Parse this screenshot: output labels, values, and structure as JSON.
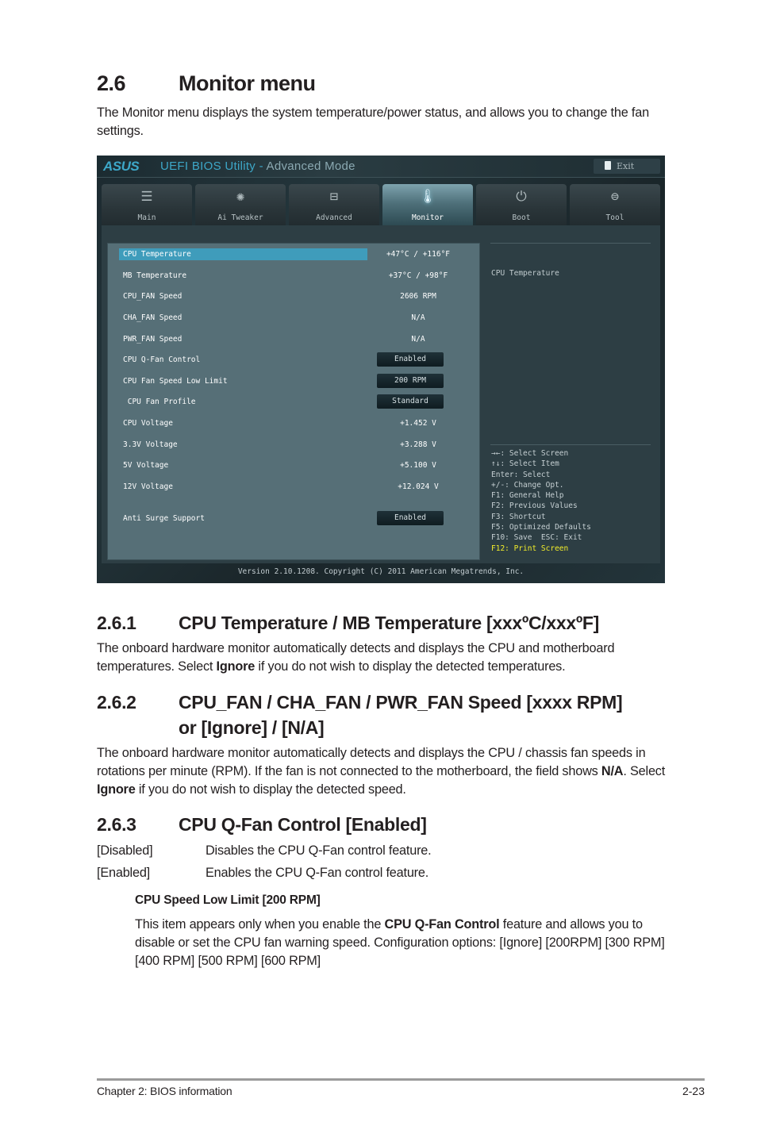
{
  "section": {
    "number": "2.6",
    "title": "Monitor menu",
    "intro": "The Monitor menu displays the system temperature/power status, and allows you to change the fan settings."
  },
  "bios": {
    "logo": "ASUS",
    "title": "UEFI BIOS Utility - ",
    "mode": "Advanced Mode",
    "exit_label": "Exit",
    "tabs": [
      {
        "label": "Main",
        "icon": "list-icon",
        "glyph": "☰",
        "active": false
      },
      {
        "label": "Ai Tweaker",
        "icon": "tweaker-icon",
        "glyph": "✺",
        "active": false
      },
      {
        "label": "Advanced",
        "icon": "advanced-icon",
        "glyph": "⊟",
        "active": false
      },
      {
        "label": "Monitor",
        "icon": "thermometer-icon",
        "glyph": "🌡",
        "active": true
      },
      {
        "label": "Boot",
        "icon": "power-icon",
        "glyph": "⏻",
        "active": false
      },
      {
        "label": "Tool",
        "icon": "toolbox-icon",
        "glyph": "⊜",
        "active": false
      }
    ],
    "items": [
      {
        "label": "CPU Temperature",
        "value": "+47°C / +116°F",
        "type": "text",
        "selected": true
      },
      {
        "label": "MB Temperature",
        "value": "+37°C / +98°F",
        "type": "text"
      },
      {
        "label": "CPU_FAN Speed",
        "value": "2606 RPM",
        "type": "text"
      },
      {
        "label": "CHA_FAN Speed",
        "value": "N/A",
        "type": "text"
      },
      {
        "label": "PWR_FAN Speed",
        "value": "N/A",
        "type": "text"
      },
      {
        "label": "CPU Q-Fan Control",
        "value": "Enabled",
        "type": "button"
      },
      {
        "label": "CPU Fan Speed Low Limit",
        "value": "200 RPM",
        "type": "button"
      },
      {
        "label": " CPU Fan Profile",
        "value": "Standard",
        "type": "button"
      },
      {
        "label": "CPU Voltage",
        "value": "+1.452 V",
        "type": "text"
      },
      {
        "label": "3.3V Voltage",
        "value": "+3.288 V",
        "type": "text"
      },
      {
        "label": "5V Voltage",
        "value": "+5.100 V",
        "type": "text"
      },
      {
        "label": "12V Voltage",
        "value": "+12.024 V",
        "type": "text"
      },
      {
        "label": "Anti Surge Support",
        "value": "Enabled",
        "type": "button"
      }
    ],
    "help_text": "CPU Temperature",
    "keys": [
      "→←: Select Screen",
      "↑↓: Select Item",
      "Enter: Select",
      "+/-: Change Opt.",
      "F1: General Help",
      "F2: Previous Values",
      "F3: Shortcut",
      "F5: Optimized Defaults",
      "F10: Save  ESC: Exit",
      "F12: Print Screen"
    ],
    "version": "Version 2.10.1208. Copyright (C) 2011 American Megatrends, Inc.",
    "colors": {
      "accent": "#3da7c8",
      "highlight_key": "#f3ee2a",
      "panel": "#566f77"
    }
  },
  "s261": {
    "number": "2.6.1",
    "title": "CPU Temperature / MB Temperature [xxxºC/xxxºF]",
    "p1": "The onboard hardware monitor automatically detects and displays the CPU and motherboard temperatures. Select ",
    "p1_bold": "Ignore",
    "p1_end": " if you do not wish to display the detected temperatures."
  },
  "s262": {
    "number": "2.6.2",
    "title_line1": "CPU_FAN / CHA_FAN / PWR_FAN Speed [xxxx RPM]",
    "title_line2": "or [Ignore] / [N/A]",
    "p1": "The onboard hardware monitor automatically detects and displays the CPU / chassis fan speeds in rotations per minute (RPM). If the fan is not connected to the motherboard, the field shows ",
    "p1_bold1": "N/A",
    "p1_mid": ". Select ",
    "p1_bold2": "Ignore",
    "p1_end": " if you do not wish to display the detected speed."
  },
  "s263": {
    "number": "2.6.3",
    "title": "CPU Q-Fan Control [Enabled]",
    "options": [
      {
        "key": "[Disabled]",
        "desc": "Disables the CPU Q-Fan control feature."
      },
      {
        "key": "[Enabled]",
        "desc": "Enables the CPU Q-Fan control feature."
      }
    ],
    "sub_title": "CPU Speed Low Limit [200 RPM]",
    "sub_p1": "This item appears only when you enable the ",
    "sub_bold": "CPU Q-Fan Control",
    "sub_p2": " feature and allows you to disable or set the CPU fan warning speed. Configuration options: [Ignore] [200RPM] [300 RPM] [400 RPM] [500 RPM] [600 RPM]"
  },
  "footer": {
    "chapter": "Chapter 2: BIOS information",
    "page": "2-23"
  }
}
